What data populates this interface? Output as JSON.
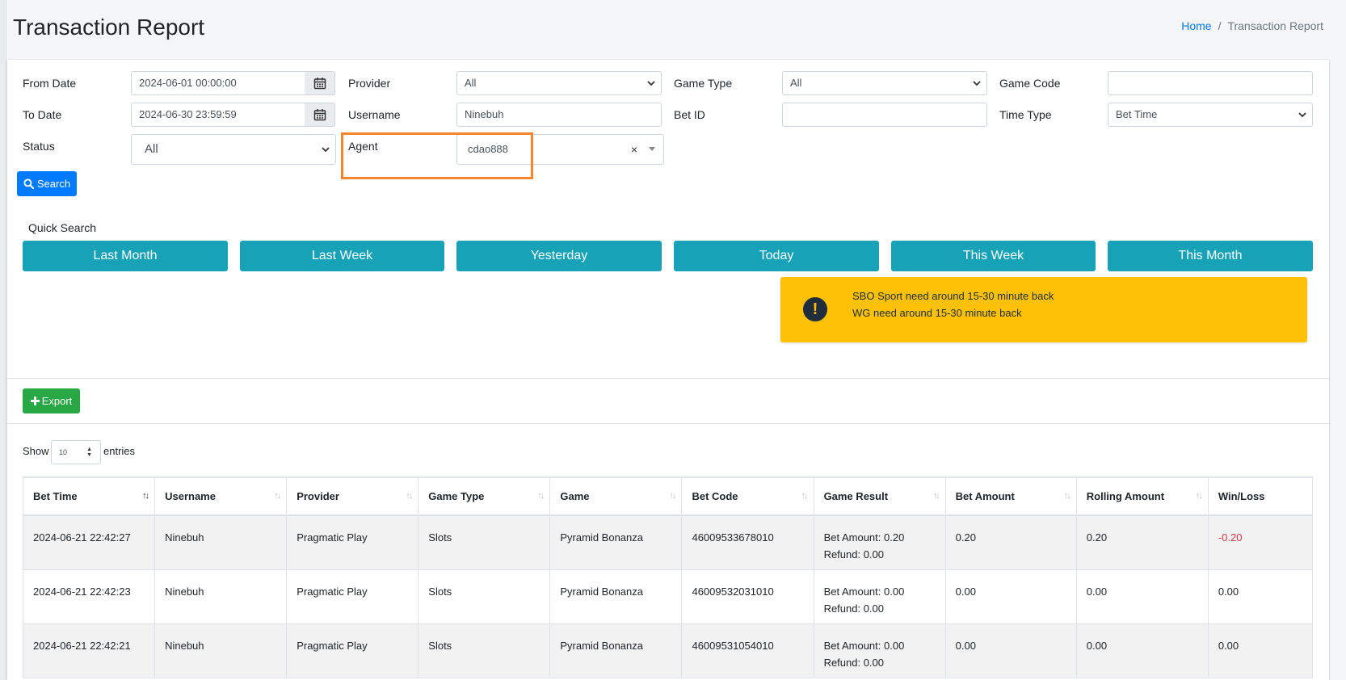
{
  "page": {
    "title": "Transaction Report"
  },
  "breadcrumb": {
    "home": "Home",
    "current": "Transaction Report"
  },
  "filters": {
    "from_date": {
      "label": "From Date",
      "value": "2024-06-01 00:00:00"
    },
    "to_date": {
      "label": "To Date",
      "value": "2024-06-30 23:59:59"
    },
    "status": {
      "label": "Status",
      "value": "All"
    },
    "provider": {
      "label": "Provider",
      "value": "All"
    },
    "username": {
      "label": "Username",
      "value": "Ninebuh"
    },
    "agent": {
      "label": "Agent",
      "value": "cdao888"
    },
    "game_type": {
      "label": "Game Type",
      "value": "All"
    },
    "bet_id": {
      "label": "Bet ID",
      "value": ""
    },
    "game_code": {
      "label": "Game Code",
      "value": ""
    },
    "time_type": {
      "label": "Time Type",
      "value": "Bet Time"
    }
  },
  "search_label": "Search",
  "quick_search": {
    "label": "Quick Search",
    "buttons": [
      "Last Month",
      "Last Week",
      "Yesterday",
      "Today",
      "This Week",
      "This Month"
    ]
  },
  "alert": {
    "lines": [
      "SBO Sport need around 15-30 minute back",
      "WG need around 15-30 minute back"
    ]
  },
  "export_label": "Export",
  "entries": {
    "show": "Show",
    "value": "10",
    "suffix": "entries"
  },
  "table": {
    "columns": [
      "Bet Time",
      "Username",
      "Provider",
      "Game Type",
      "Game",
      "Bet Code",
      "Game Result",
      "Bet Amount",
      "Rolling Amount",
      "Win/Loss"
    ],
    "rows": [
      {
        "bet_time": "2024-06-21 22:42:27",
        "username": "Ninebuh",
        "provider": "Pragmatic Play",
        "game_type": "Slots",
        "game": "Pyramid Bonanza",
        "bet_code": "46009533678010",
        "result_line1": "Bet Amount: 0.20",
        "result_line2": "Refund: 0.00",
        "bet_amount": "0.20",
        "rolling_amount": "0.20",
        "win_loss": "-0.20"
      },
      {
        "bet_time": "2024-06-21 22:42:23",
        "username": "Ninebuh",
        "provider": "Pragmatic Play",
        "game_type": "Slots",
        "game": "Pyramid Bonanza",
        "bet_code": "46009532031010",
        "result_line1": "Bet Amount: 0.00",
        "result_line2": "Refund: 0.00",
        "bet_amount": "0.00",
        "rolling_amount": "0.00",
        "win_loss": "0.00"
      },
      {
        "bet_time": "2024-06-21 22:42:21",
        "username": "Ninebuh",
        "provider": "Pragmatic Play",
        "game_type": "Slots",
        "game": "Pyramid Bonanza",
        "bet_code": "46009531054010",
        "result_line1": "Bet Amount: 0.00",
        "result_line2": "Refund: 0.00",
        "bet_amount": "0.00",
        "rolling_amount": "0.00",
        "win_loss": "0.00"
      }
    ]
  },
  "colors": {
    "primary": "#007bff",
    "info": "#17a2b8",
    "success": "#28a745",
    "warning": "#ffc107",
    "danger": "#dc3545",
    "highlight": "#f7852d"
  }
}
